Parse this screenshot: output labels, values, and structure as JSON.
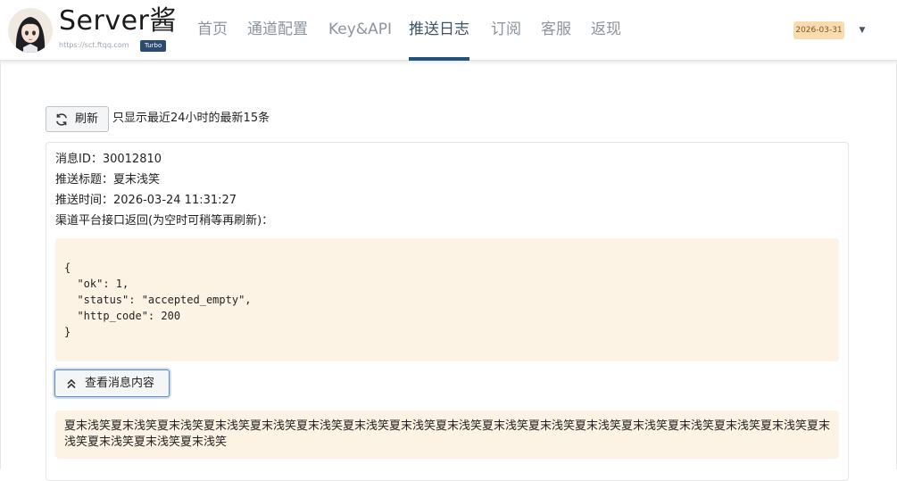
{
  "brand": {
    "title": "Server酱",
    "url": "https://sct.ftqq.com",
    "badge": "Turbo"
  },
  "nav": {
    "items": [
      {
        "label": "首页"
      },
      {
        "label": "通道配置"
      },
      {
        "label": "Key&API"
      },
      {
        "label": "推送日志"
      },
      {
        "label": "订阅"
      },
      {
        "label": "客服"
      },
      {
        "label": "返现"
      }
    ],
    "active": "推送日志"
  },
  "user": {
    "expire_date": "2026-03-31",
    "menu_icon": "caret-down-icon"
  },
  "toolbar": {
    "refresh_label": "刷新",
    "refresh_icon": "refresh-icon",
    "hint": "只显示最近24小时的最新15条"
  },
  "message": {
    "id_line": "消息ID：30012810",
    "title_line": "推送标题：夏末浅笑",
    "time_line": "推送时间：2026-03-24 11:31:27",
    "channel_line": "渠道平台接口返回(为空时可稍等再刷新)：",
    "response_json": "{\n  \"ok\": 1,\n  \"status\": \"accepted_empty\",\n  \"http_code\": 200\n}",
    "view_button_label": "查看消息内容",
    "view_button_icon": "chevrons-up-icon",
    "content": "夏末浅笑夏末浅笑夏末浅笑夏末浅笑夏末浅笑夏末浅笑夏末浅笑夏末浅笑夏末浅笑夏末浅笑夏末浅笑夏末浅笑夏末浅笑夏末浅笑夏末浅笑夏末浅笑夏末浅笑夏末浅笑夏末浅笑夏末浅笑"
  },
  "colors": {
    "accent": "#21547b",
    "code_background": "#fcf3e4",
    "date_badge": "#f8dcae",
    "brand_badge": "#2b4b6f"
  }
}
